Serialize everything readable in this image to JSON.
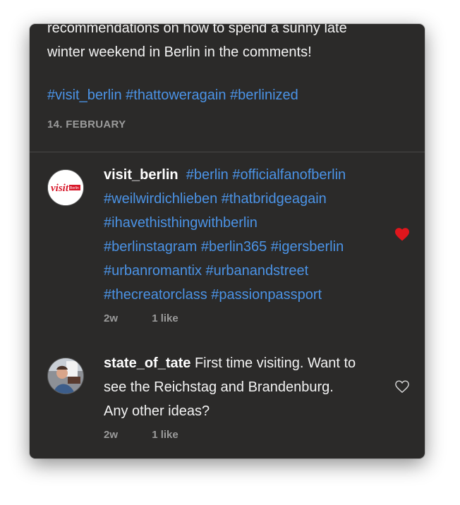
{
  "post": {
    "caption_line1": "recommendations on how to spend a sunny late",
    "caption_line2": "winter weekend in Berlin in the comments!",
    "hashtags": "#visit_berlin #thattoweragain #berlinized",
    "date": "14. FEBRUARY"
  },
  "comments": [
    {
      "username": "visit_berlin",
      "avatar_label": "visit Berlin",
      "lines": [
        "#berlin #officialfanofberlin",
        "#weilwirdichlieben #thatbridgeagain",
        "#ihavethisthingwithberlin",
        "#berlinstagram #berlin365 #igersberlin",
        "#urbanromantix #urbanandstreet",
        "#thecreatorclass #passionpassport"
      ],
      "age": "2w",
      "likes": "1 like",
      "liked": true,
      "heart_icon": "heart-filled-icon"
    },
    {
      "username": "state_of_tate",
      "text_first": "First time visiting. Want to",
      "text_line2": "see the Reichstag and Brandenburg.",
      "text_line3": "Any other ideas?",
      "age": "2w",
      "likes": "1 like",
      "liked": false,
      "heart_icon": "heart-outline-icon"
    }
  ],
  "colors": {
    "background": "#2b2a29",
    "link": "#4b93e6",
    "muted": "#9b9b9b",
    "liked_heart": "#e0161c"
  }
}
